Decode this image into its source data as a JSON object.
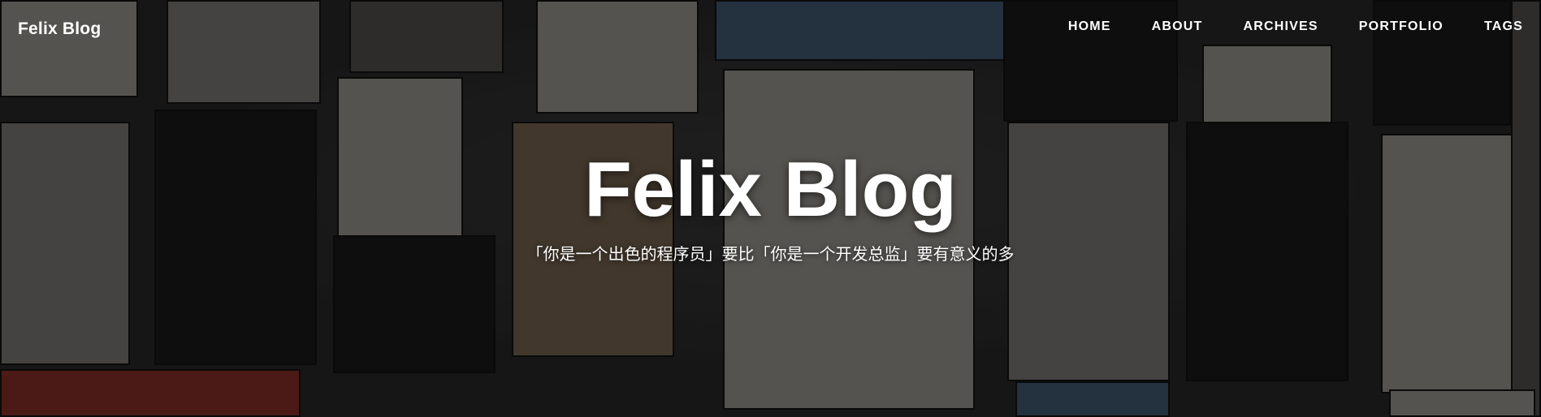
{
  "site": {
    "brand": "Felix Blog"
  },
  "nav": {
    "items": [
      {
        "label": "HOME"
      },
      {
        "label": "ABOUT"
      },
      {
        "label": "ARCHIVES"
      },
      {
        "label": "PORTFOLIO"
      },
      {
        "label": "TAGS"
      }
    ]
  },
  "hero": {
    "title": "Felix Blog",
    "subtitle": "「你是一个出色的程序员」要比「你是一个开发总监」要有意义的多"
  },
  "colors": {
    "text": "#ffffff",
    "overlay": "#000000"
  }
}
